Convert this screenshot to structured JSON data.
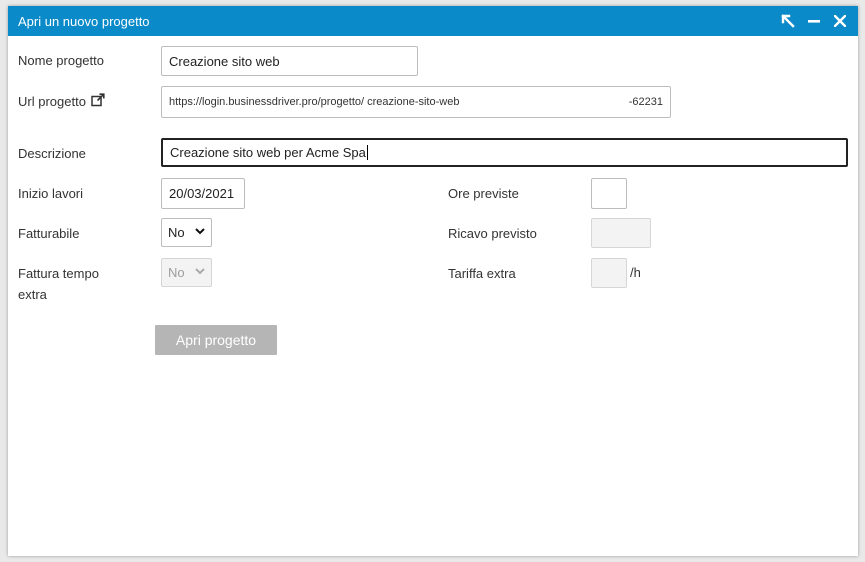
{
  "window": {
    "title": "Apri un nuovo progetto"
  },
  "form": {
    "nome_label": "Nome progetto",
    "nome_value": "Creazione sito web",
    "url_label": "Url progetto",
    "url_prefix": "https://login.businessdriver.pro/progetto/",
    "url_slug": "creazione-sito-web",
    "url_suffix": "-62231",
    "descrizione_label": "Descrizione",
    "descrizione_value": "Creazione sito web per Acme Spa",
    "inizio_label": "Inizio lavori",
    "inizio_value": "20/03/2021",
    "fatturabile_label": "Fatturabile",
    "fatturabile_value": "No",
    "fattura_extra_label_1": "Fattura tempo",
    "fattura_extra_label_2": "extra",
    "fattura_extra_value": "No",
    "ore_label": "Ore previste",
    "ore_value": "",
    "ricavo_label": "Ricavo previsto",
    "ricavo_value": "",
    "tariffa_label": "Tariffa extra",
    "tariffa_value": "",
    "tariffa_unit": "/h"
  },
  "actions": {
    "submit_label": "Apri progetto"
  }
}
